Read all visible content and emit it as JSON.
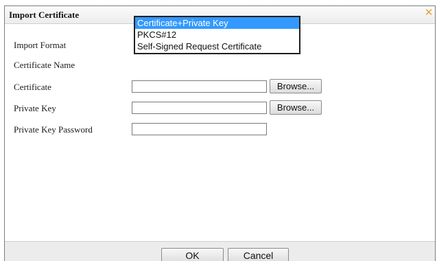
{
  "dialog": {
    "title": "Import Certificate",
    "close_glyph": "✕"
  },
  "form": {
    "import_format_label": "Import Format",
    "certificate_name_label": "Certificate Name",
    "certificate_label": "Certificate",
    "private_key_label": "Private Key",
    "private_key_password_label": "Private Key Password",
    "certificate_value": "",
    "private_key_value": "",
    "private_key_password_value": "",
    "browse_label": "Browse..."
  },
  "import_format": {
    "options": [
      "Certificate+Private Key",
      "PKCS#12",
      "Self-Signed Request Certificate"
    ],
    "selected": "Certificate+Private Key"
  },
  "footer": {
    "ok_label": "OK",
    "cancel_label": "Cancel"
  },
  "colors": {
    "selection_highlight": "#3399ff",
    "close_icon": "#e8a23a"
  }
}
